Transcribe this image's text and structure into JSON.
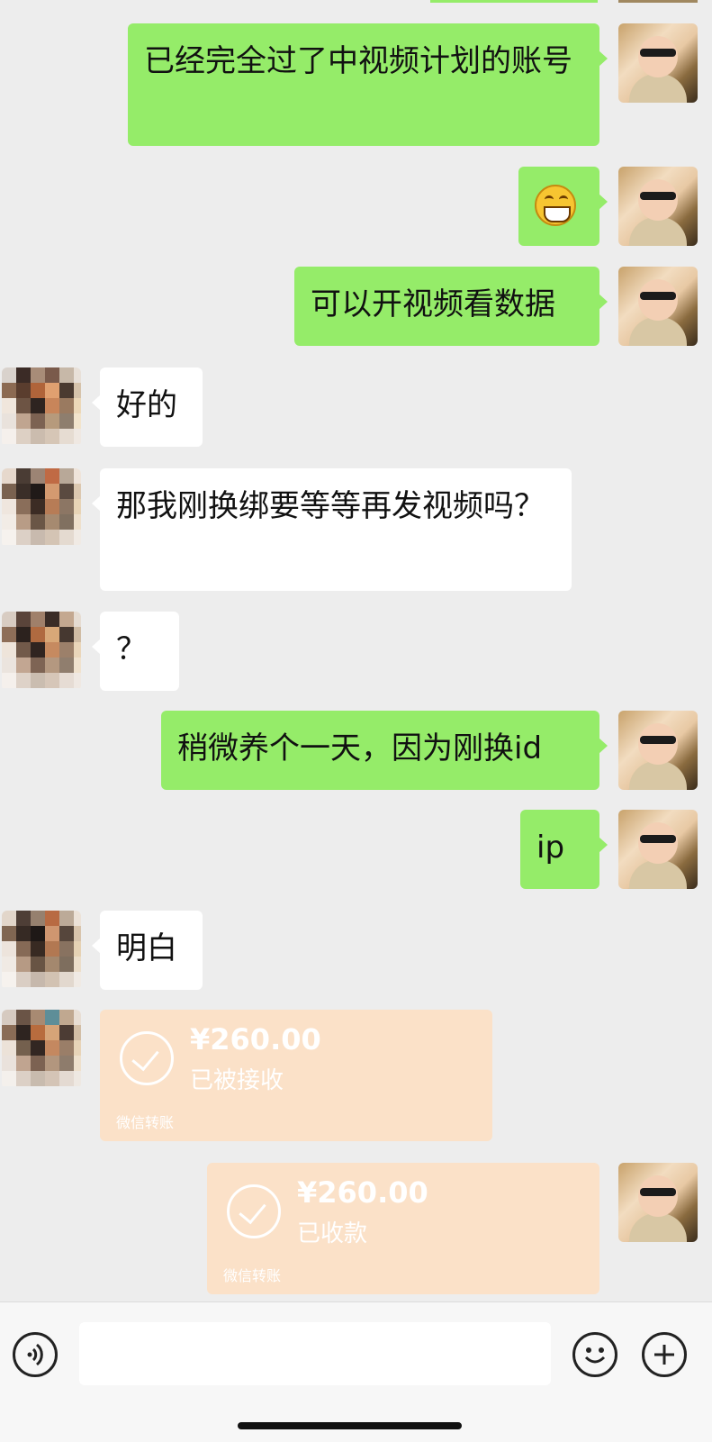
{
  "colors": {
    "outgoing": "#95ec69",
    "incoming": "#ffffff",
    "transfer": "#fbe1c8",
    "background": "#ededed"
  },
  "messages": [
    {
      "side": "out",
      "text": "已经完全过了中视频计划的账号"
    },
    {
      "side": "out",
      "emoji": "grinning-face"
    },
    {
      "side": "out",
      "text": "可以开视频看数据"
    },
    {
      "side": "in",
      "text": "好的"
    },
    {
      "side": "in",
      "text": "那我刚换绑要等等再发视频吗？"
    },
    {
      "side": "in",
      "text": "？"
    },
    {
      "side": "out",
      "text": "稍微养个一天，因为刚换id"
    },
    {
      "side": "out",
      "text": "ip"
    },
    {
      "side": "in",
      "text": "明白"
    },
    {
      "side": "in",
      "transfer": {
        "amount": "¥260.00",
        "status": "已被接收",
        "brand": "微信转账"
      }
    },
    {
      "side": "out",
      "transfer": {
        "amount": "¥260.00",
        "status": "已收款",
        "brand": "微信转账"
      }
    }
  ],
  "input_bar": {
    "voice_icon": "voice-icon",
    "emoji_icon": "emoji-icon",
    "plus_icon": "plus-icon"
  }
}
